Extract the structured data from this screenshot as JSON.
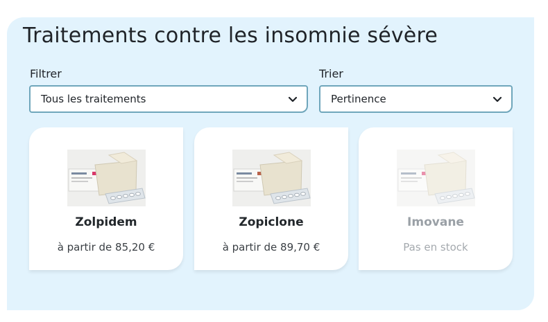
{
  "title": "Traitements contre les insomnie sévère",
  "filter": {
    "label": "Filtrer",
    "value": "Tous les traitements",
    "icon": "chevron-down-icon"
  },
  "sort": {
    "label": "Trier",
    "value": "Pertinence",
    "icon": "chevron-down-icon"
  },
  "colors": {
    "panel": "#e2f3fd",
    "select_border": "#6fa6bb",
    "card": "#ffffff",
    "muted": "#9aa0a6"
  },
  "products": [
    {
      "name": "Zolpidem",
      "price": "à partir de 85,20 €",
      "available": true,
      "box_accent": "#d9386a"
    },
    {
      "name": "Zopiclone",
      "price": "à partir de 89,70 €",
      "available": true,
      "box_accent": "#b8634a"
    },
    {
      "name": "Imovane",
      "price": "Pas en stock",
      "available": false,
      "box_accent": "#d9386a"
    }
  ]
}
